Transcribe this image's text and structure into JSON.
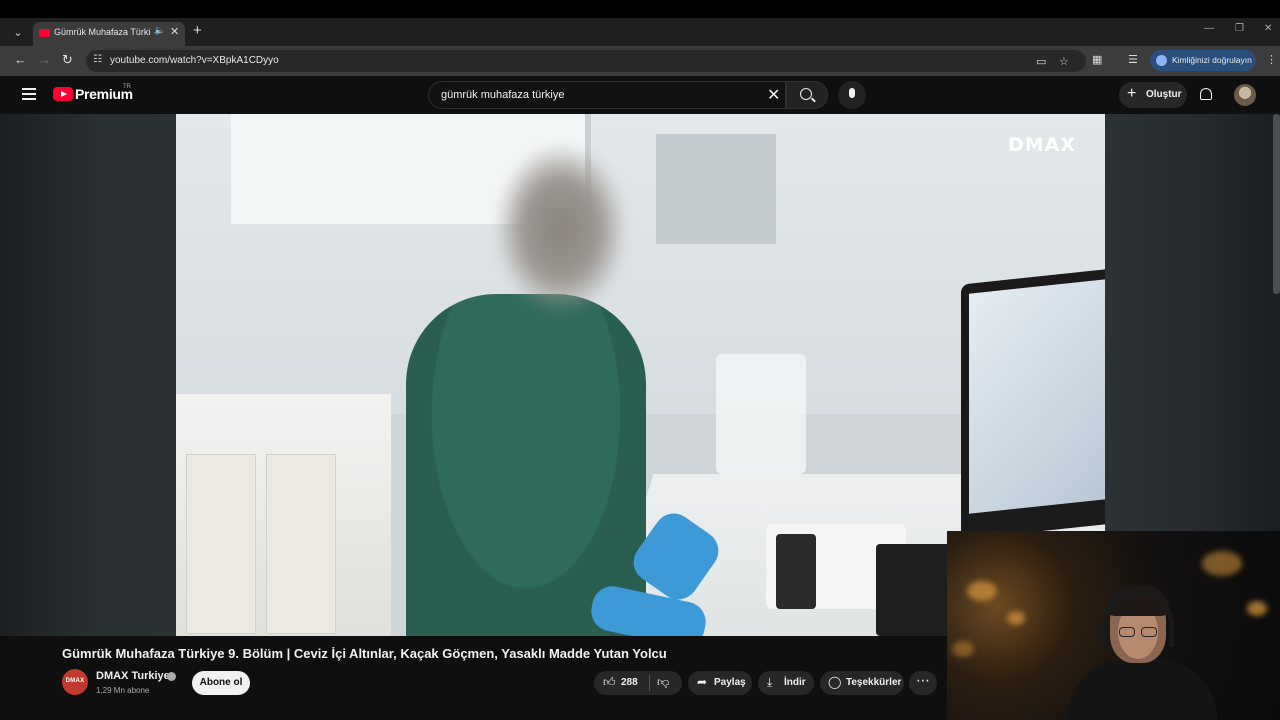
{
  "browser": {
    "tab": {
      "title": "Gümrük Muhafaza Türkiye",
      "audio_icon": "speaker-icon",
      "close_icon": "close-icon"
    },
    "new_tab_icon": "plus-icon",
    "url": "youtube.com/watch?v=XBpkA1CDyyo",
    "profile_chip": "Kimliğinizi doğrulayın"
  },
  "youtube": {
    "logo_text": "Premium",
    "region": "TR",
    "search": {
      "query": "gümrük muhafaza türkiye"
    },
    "create_label": "Oluştur"
  },
  "video": {
    "watermark": "DMAX",
    "title": "Gümrük Muhafaza Türkiye 9. Bölüm | Ceviz İçi Altınlar, Kaçak Göçmen, Yasaklı Madde Yutan Yolcu"
  },
  "channel": {
    "avatar_text": "DMAX",
    "name": "DMAX Turkiye",
    "subscribers": "1,29 Mn abone",
    "subscribe_label": "Abone ol"
  },
  "actions": {
    "likes": "288",
    "share": "Paylaş",
    "download": "İndir",
    "thanks": "Teşekkürler"
  },
  "colors": {
    "brand_red": "#ff0033",
    "background": "#0f0f0f",
    "pill": "#272727"
  }
}
